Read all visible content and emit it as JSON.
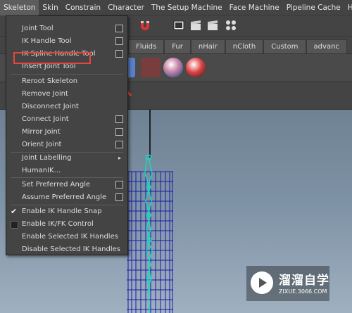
{
  "menubar": {
    "items": [
      "Skeleton",
      "Skin",
      "Constrain",
      "Character",
      "The Setup Machine",
      "Face Machine",
      "Pipeline Cache",
      "Help"
    ]
  },
  "shelf": {
    "tabs": [
      "Fluids",
      "Fur",
      "nHair",
      "nCloth",
      "Custom",
      "advanc"
    ]
  },
  "menu": {
    "items": [
      {
        "label": "Joint Tool",
        "option": true
      },
      {
        "label": "IK Handle Tool",
        "option": true
      },
      {
        "label": "IK Spline Handle Tool",
        "option": true
      },
      {
        "label": "Insert Joint Tool",
        "option": false
      },
      {
        "label": "Reroot Skeleton",
        "option": false
      },
      {
        "label": "Remove Joint",
        "option": false
      },
      {
        "label": "Disconnect Joint",
        "option": false
      },
      {
        "label": "Connect Joint",
        "option": true
      },
      {
        "label": "Mirror Joint",
        "option": true
      },
      {
        "label": "Orient Joint",
        "option": true
      },
      {
        "label": "Joint Labelling",
        "submenu": true
      },
      {
        "label": "HumanIK...",
        "option": false
      },
      {
        "label": "Set Preferred Angle",
        "option": true
      },
      {
        "label": "Assume Preferred Angle",
        "option": true
      },
      {
        "label": "Enable IK Handle Snap",
        "checked": true
      },
      {
        "label": "Enable IK/FK Control",
        "checkbox": true
      },
      {
        "label": "Enable Selected IK Handles",
        "option": false
      },
      {
        "label": "Disable Selected IK Handles",
        "option": false
      }
    ],
    "highlighted": "IK Handle Tool",
    "highlight_color": "#e8453c"
  },
  "watermark": {
    "brand": "溜溜自学",
    "url": "ZIXUE.3066.COM"
  },
  "colors": {
    "menu_bg": "#444444",
    "viewport_top": "#6f8294",
    "viewport_bottom": "#9fb0c0",
    "mesh": "#1a1aa8",
    "joint": "#19d9c0",
    "annotation": "#e8453c"
  }
}
